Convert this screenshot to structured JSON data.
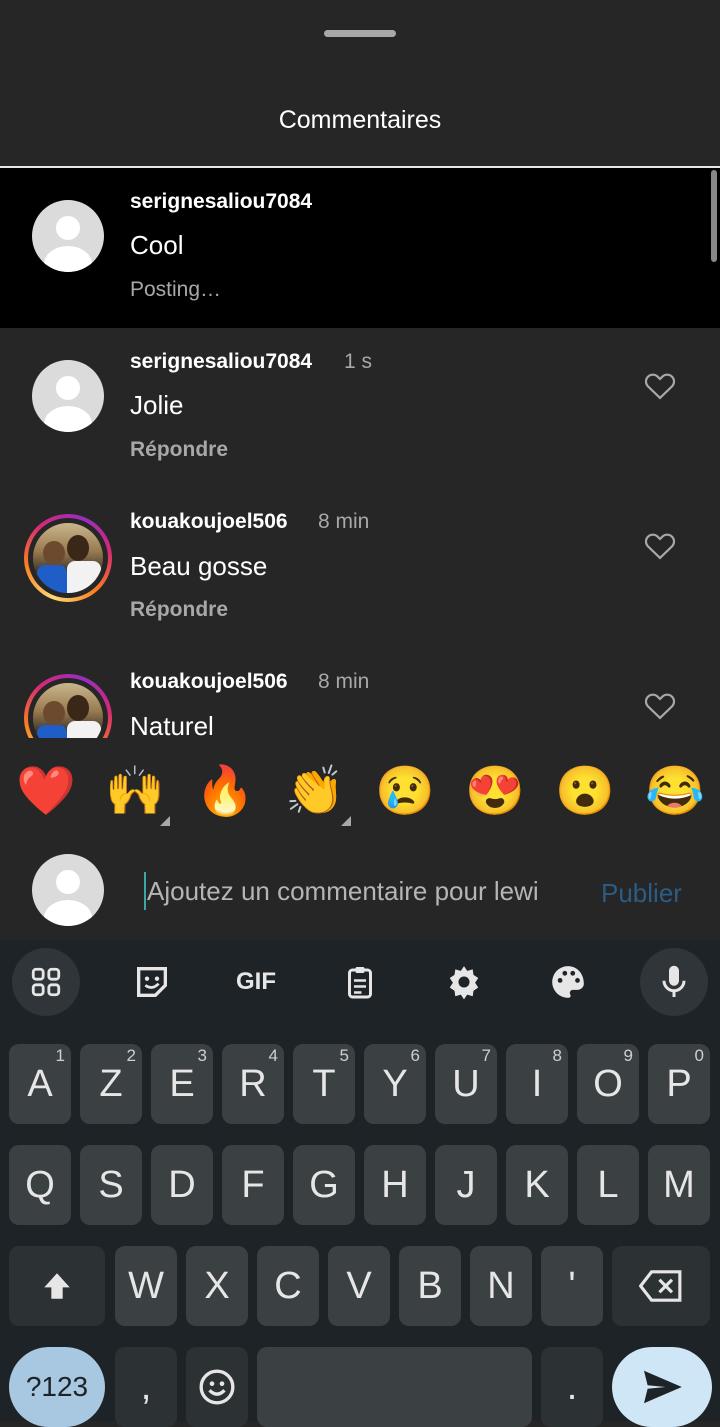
{
  "sheet": {
    "title": "Commentaires"
  },
  "pending_comment": {
    "username": "serignesaliou7084",
    "text": "Cool",
    "status": "Posting…"
  },
  "comments": [
    {
      "username": "serignesaliou7084",
      "time": "1 s",
      "text": "Jolie",
      "reply": "Répondre"
    },
    {
      "username": "kouakoujoel506",
      "time": "8 min",
      "text": "Beau gosse",
      "reply": "Répondre"
    },
    {
      "username": "kouakoujoel506",
      "time": "8 min",
      "text": "Naturel"
    }
  ],
  "reactions": [
    "❤️",
    "🙌",
    "🔥",
    "👏",
    "😢",
    "😍",
    "😮",
    "😂"
  ],
  "composer": {
    "placeholder": "Ajoutez un commentaire pour lewi",
    "publish": "Publier"
  },
  "keyboard": {
    "toolbar": [
      "apps-grid-icon",
      "sticker-icon",
      "gif",
      "clipboard-icon",
      "settings-icon",
      "palette-icon",
      "mic-icon"
    ],
    "gif_label": "GIF",
    "row1": [
      {
        "k": "A",
        "n": "1"
      },
      {
        "k": "Z",
        "n": "2"
      },
      {
        "k": "E",
        "n": "3"
      },
      {
        "k": "R",
        "n": "4"
      },
      {
        "k": "T",
        "n": "5"
      },
      {
        "k": "Y",
        "n": "6"
      },
      {
        "k": "U",
        "n": "7"
      },
      {
        "k": "I",
        "n": "8"
      },
      {
        "k": "O",
        "n": "9"
      },
      {
        "k": "P",
        "n": "0"
      }
    ],
    "row2": [
      "Q",
      "S",
      "D",
      "F",
      "G",
      "H",
      "J",
      "K",
      "L",
      "M"
    ],
    "row3": [
      "W",
      "X",
      "C",
      "V",
      "B",
      "N",
      "'"
    ],
    "symbols": "?123",
    "comma": ",",
    "period": "."
  }
}
